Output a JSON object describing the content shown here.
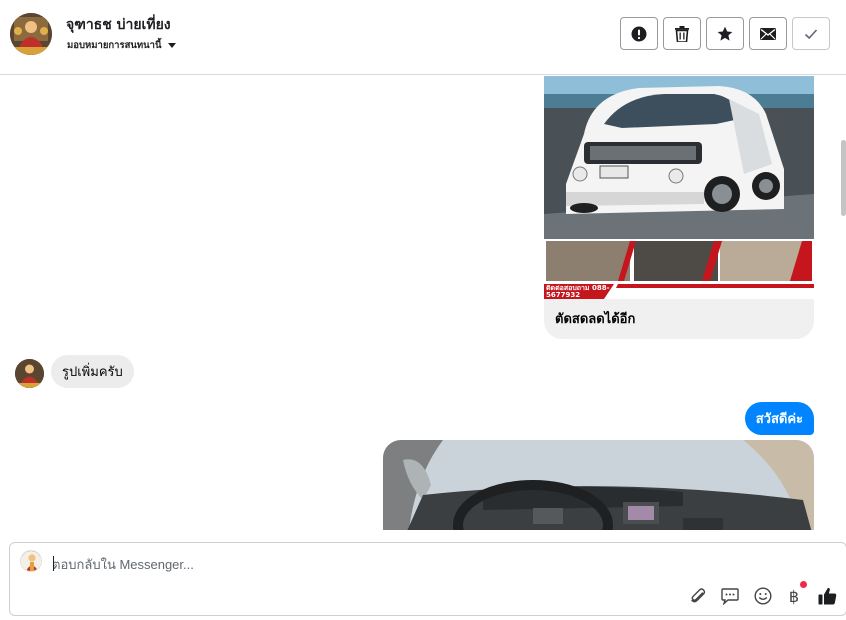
{
  "header": {
    "contact_name": "จุฑาธช บ่ายเที่ยง",
    "assign_label": "มอบหมายการสนทนานี้",
    "buttons": [
      {
        "name": "spam",
        "icon": "exclamation-circle-icon"
      },
      {
        "name": "delete",
        "icon": "trash-icon"
      },
      {
        "name": "star",
        "icon": "star-icon"
      },
      {
        "name": "mark-unread",
        "icon": "envelope-icon"
      },
      {
        "name": "done",
        "icon": "checkmark-icon"
      }
    ]
  },
  "thread": {
    "messages": [
      {
        "direction": "incoming",
        "type": "image-card",
        "caption": "ตัดสดลดได้อีก",
        "image_overlay_text": "ติดต่อสอบถาม 088-5677932"
      },
      {
        "direction": "incoming",
        "type": "text",
        "text": "รูปเพิ่มครับ"
      },
      {
        "direction": "outgoing",
        "type": "text",
        "text": "สวัสดีค่ะ"
      },
      {
        "direction": "outgoing",
        "type": "image"
      }
    ]
  },
  "composer": {
    "placeholder": "ตอบกลับใน Messenger...",
    "tools": [
      "paperclip-icon",
      "chat-bubble-icon",
      "smiley-icon",
      "baht-icon",
      "thumbs-up-icon"
    ],
    "baht_symbol": "฿"
  },
  "colors": {
    "accent": "#0084ff",
    "incoming_bubble": "#ececec",
    "notification_dot": "#f02849",
    "banner_red": "#c4161c"
  }
}
